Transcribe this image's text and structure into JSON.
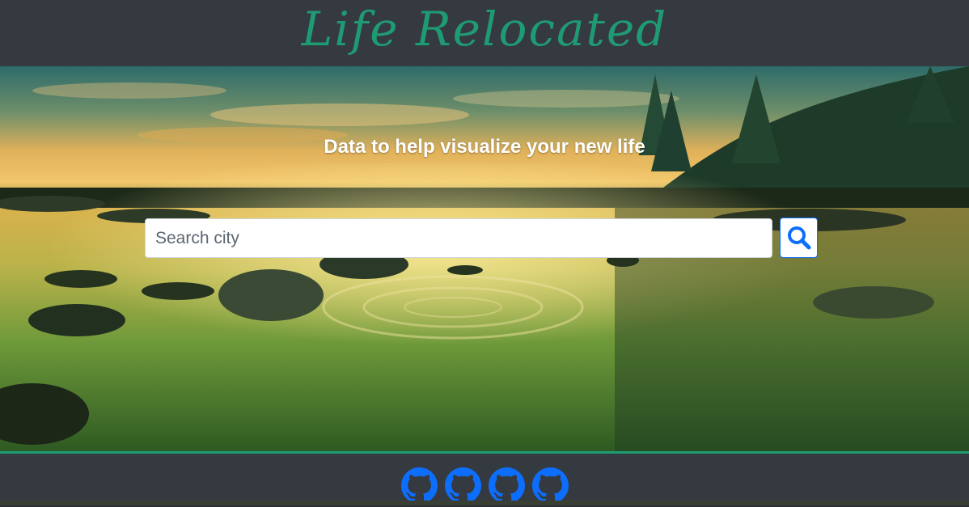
{
  "header": {
    "brand": "Life Relocated",
    "brand_color": "#1f9b74",
    "background": "#343a40"
  },
  "hero": {
    "tagline": "Data to help visualize your new life",
    "image_description_icon": "lake-sunset-image"
  },
  "search": {
    "placeholder": "Search city",
    "value": "",
    "button_icon": "search-icon",
    "accent": "#0d6efd"
  },
  "footer": {
    "links": [
      {
        "icon": "github-icon"
      },
      {
        "icon": "github-icon"
      },
      {
        "icon": "github-icon"
      },
      {
        "icon": "github-icon"
      }
    ],
    "icon_color": "#0d6efd",
    "divider_color": "#1f9b74"
  }
}
